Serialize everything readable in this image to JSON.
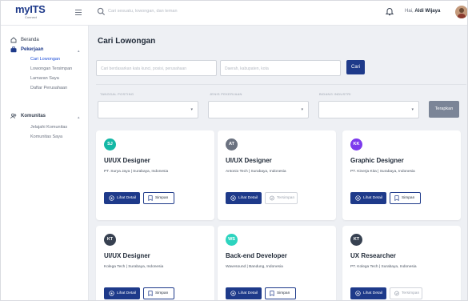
{
  "header": {
    "logo_text": "myITS",
    "logo_sub": "Connect",
    "search_placeholder": "Cari sesuatu, lowongan, dan teman",
    "greeting_prefix": "Hai, ",
    "user_name": "Aldi Wijaya"
  },
  "sidebar": {
    "items": [
      {
        "label": "Beranda",
        "icon": "home-icon"
      },
      {
        "label": "Pekerjaan",
        "icon": "briefcase-icon",
        "active": true,
        "children": [
          "Cari Lowongan",
          "Lowongan Tersimpan",
          "Lamaran Saya",
          "Daftar Perusahaan"
        ]
      },
      {
        "label": "Komunitas",
        "icon": "users-icon",
        "children": [
          "Jelajahi Komunitas",
          "Komunitas Saya"
        ]
      }
    ]
  },
  "main": {
    "title": "Cari Lowongan",
    "keyword_placeholder": "Cari berdasarkan kata kunci, posisi, perusahaan",
    "location_placeholder": "Daerah, kabupaten, kota",
    "search_button": "Cari",
    "filters": [
      {
        "label": "TANGGAL POSTING"
      },
      {
        "label": "JENIS PEKERJAAN"
      },
      {
        "label": "BIDANG INDUSTRI"
      }
    ],
    "apply_button": "Terapkan"
  },
  "jobs": [
    {
      "initials": "SJ",
      "color": "#14b8a6",
      "title": "UI/UX Designer",
      "company": "PT. Surya Jaya | Surabaya, Indonesia",
      "detail_label": "Lihat Detail",
      "save_label": "Simpan",
      "saved": false
    },
    {
      "initials": "AT",
      "color": "#6b7280",
      "title": "UI/UX Designer",
      "company": "Antonio Tech | Surabaya, Indonesia",
      "detail_label": "Lihat Detail",
      "save_label": "Tersimpan",
      "saved": true
    },
    {
      "initials": "KK",
      "color": "#7c3aed",
      "title": "Graphic Designer",
      "company": "PT. Kinerja Kita | Surabaya, Indonesia",
      "detail_label": "Lihat Detail",
      "save_label": "Simpan",
      "saved": false
    },
    {
      "initials": "KT",
      "color": "#374151",
      "title": "UI/UX Designer",
      "company": "Kolega Tech | Surabaya, Indonesia",
      "detail_label": "Lihat Detail",
      "save_label": "Simpan",
      "saved": false
    },
    {
      "initials": "WS",
      "color": "#2dd4bf",
      "title": "Back-end Developer",
      "company": "Wavesound | Bandung, Indonesia",
      "detail_label": "Lihat Detail",
      "save_label": "Simpan",
      "saved": false
    },
    {
      "initials": "KT",
      "color": "#374151",
      "title": "UX Researcher",
      "company": "PT. Kolega Tech | Surabaya, Indonesia",
      "detail_label": "Lihat Detail",
      "save_label": "Tersimpan",
      "saved": true
    }
  ]
}
